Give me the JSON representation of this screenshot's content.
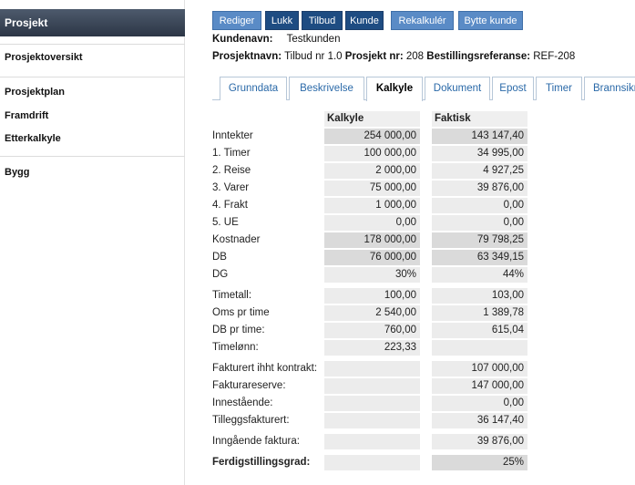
{
  "sidebar": {
    "active": "Prosjekt",
    "items": [
      "Prosjektoversikt",
      "Prosjektplan",
      "Framdrift",
      "Etterkalkyle",
      "Bygg"
    ]
  },
  "toolbar": {
    "buttons": [
      "Rediger",
      "Lukk",
      "Tilbud",
      "Kunde",
      "Rekalkulér",
      "Bytte kunde"
    ]
  },
  "info": {
    "kundenavn_label": "Kundenavn:",
    "kundenavn": "Testkunden",
    "prosjektnavn_label": "Prosjektnavn:",
    "prosjektnavn": "Tilbud nr 1.0",
    "prosjektnr_label": "Prosjekt nr:",
    "prosjektnr": "208",
    "bestref_label": "Bestillingsreferanse:",
    "bestref": "REF-208"
  },
  "tabs": [
    "Grunndata",
    "Beskrivelse",
    "Kalkyle",
    "Dokument",
    "Epost",
    "Timer",
    "Brannsikr"
  ],
  "table": {
    "col1": "Kalkyle",
    "col2": "Faktisk",
    "rows": [
      {
        "label": "Inntekter",
        "kalkyle": "254 000,00",
        "faktisk": "143 147,40"
      },
      {
        "label": "1. Timer",
        "kalkyle": "100 000,00",
        "faktisk": "34 995,00"
      },
      {
        "label": "2. Reise",
        "kalkyle": "2 000,00",
        "faktisk": "4 927,25"
      },
      {
        "label": "3. Varer",
        "kalkyle": "75 000,00",
        "faktisk": "39 876,00"
      },
      {
        "label": "4. Frakt",
        "kalkyle": "1 000,00",
        "faktisk": "0,00"
      },
      {
        "label": "5. UE",
        "kalkyle": "0,00",
        "faktisk": "0,00"
      },
      {
        "label": "Kostnader",
        "kalkyle": "178 000,00",
        "faktisk": "79 798,25"
      },
      {
        "label": "DB",
        "kalkyle": "76 000,00",
        "faktisk": "63 349,15"
      },
      {
        "label": "DG",
        "kalkyle": "30%",
        "faktisk": "44%"
      },
      {
        "label": "Timetall:",
        "kalkyle": "100,00",
        "faktisk": "103,00"
      },
      {
        "label": "Oms pr time",
        "kalkyle": "2 540,00",
        "faktisk": "1 389,78"
      },
      {
        "label": "DB pr time:",
        "kalkyle": "760,00",
        "faktisk": "615,04"
      },
      {
        "label": "Timelønn:",
        "kalkyle": "223,33",
        "faktisk": ""
      },
      {
        "label": "Fakturert ihht kontrakt:",
        "kalkyle": "",
        "faktisk": "107 000,00"
      },
      {
        "label": "Fakturareserve:",
        "kalkyle": "",
        "faktisk": "147 000,00"
      },
      {
        "label": "Innestående:",
        "kalkyle": "",
        "faktisk": "0,00"
      },
      {
        "label": "Tilleggsfakturert:",
        "kalkyle": "",
        "faktisk": "36 147,40"
      },
      {
        "label": "Inngående faktura:",
        "kalkyle": "",
        "faktisk": "39 876,00"
      },
      {
        "label": "Ferdigstillingsgrad:",
        "kalkyle": "",
        "faktisk": "25%"
      }
    ]
  }
}
